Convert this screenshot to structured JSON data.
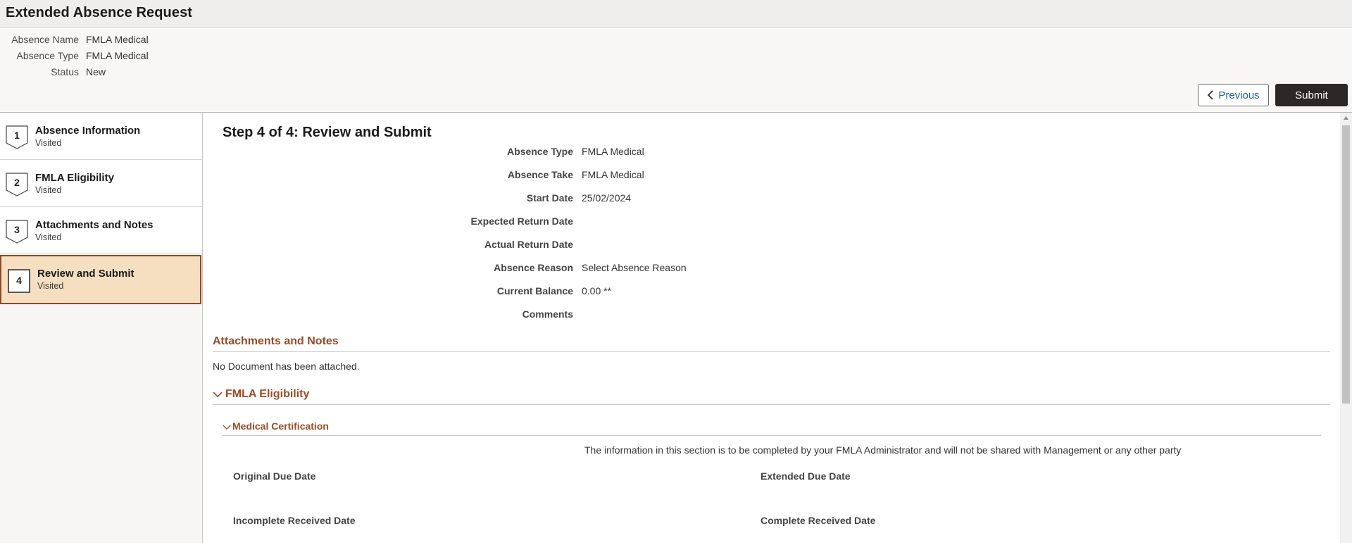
{
  "app": {
    "title": "Extended Absence Request"
  },
  "header": {
    "fields": [
      {
        "label": "Absence Name",
        "value": "FMLA Medical"
      },
      {
        "label": "Absence Type",
        "value": "FMLA Medical"
      },
      {
        "label": "Status",
        "value": "New"
      }
    ],
    "previous_label": "Previous",
    "submit_label": "Submit"
  },
  "sidebar": {
    "steps": [
      {
        "number": "1",
        "title": "Absence Information",
        "status": "Visited"
      },
      {
        "number": "2",
        "title": "FMLA Eligibility",
        "status": "Visited"
      },
      {
        "number": "3",
        "title": "Attachments and Notes",
        "status": "Visited"
      },
      {
        "number": "4",
        "title": "Review and Submit",
        "status": "Visited",
        "active": true
      }
    ]
  },
  "main": {
    "page_title": "Step 4 of 4: Review and Submit",
    "fields": [
      {
        "label": "Absence Type",
        "value": "FMLA Medical"
      },
      {
        "label": "Absence Take",
        "value": "FMLA Medical"
      },
      {
        "label": "Start Date",
        "value": "25/02/2024"
      },
      {
        "label": "Expected Return Date",
        "value": ""
      },
      {
        "label": "Actual Return Date",
        "value": ""
      },
      {
        "label": "Absence Reason",
        "value": "Select Absence Reason"
      },
      {
        "label": "Current Balance",
        "value": "0.00 **"
      },
      {
        "label": "Comments",
        "value": ""
      }
    ],
    "attachments": {
      "title": "Attachments and Notes",
      "message": "No Document has been attached."
    },
    "fmla": {
      "title": "FMLA Eligibility",
      "medical_certification": {
        "title": "Medical Certification",
        "notice": "The information in this section is to be completed by your FMLA Administrator and will not be shared with Management or any other party",
        "original_due_date_label": "Original Due Date",
        "extended_due_date_label": "Extended Due Date",
        "incomplete_received_date_label": "Incomplete Received Date",
        "complete_received_date_label": "Complete Received Date"
      }
    }
  },
  "colors": {
    "accent": "#9a4b26",
    "active_step_bg": "#f5dfc0",
    "active_step_border": "#8b4a24",
    "submit_bg": "#2b2724",
    "link_blue": "#1f5fa3"
  }
}
